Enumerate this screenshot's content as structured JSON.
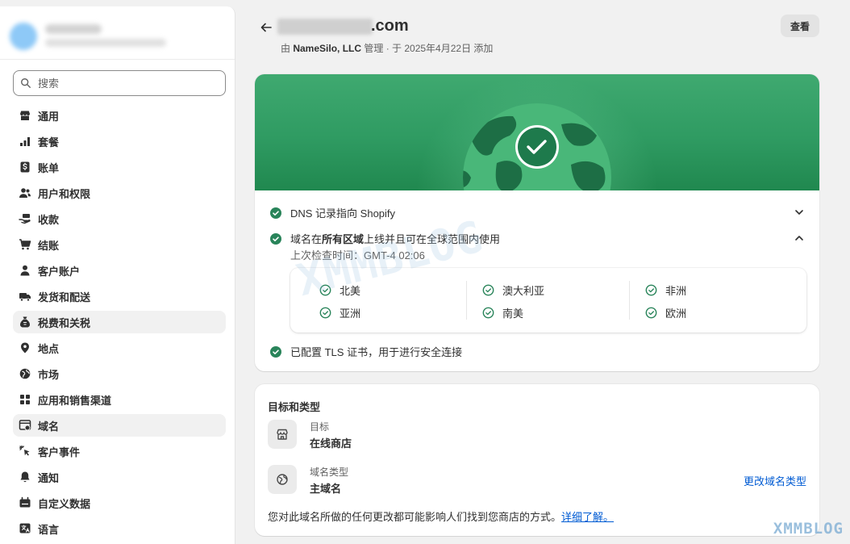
{
  "sidebar": {
    "search_placeholder": "搜索",
    "items": [
      {
        "label": "通用",
        "icon": "store-icon",
        "active": false
      },
      {
        "label": "套餐",
        "icon": "plan-chart-icon",
        "active": false
      },
      {
        "label": "账单",
        "icon": "billing-dollar-icon",
        "active": false
      },
      {
        "label": "用户和权限",
        "icon": "users-icon",
        "active": false
      },
      {
        "label": "收款",
        "icon": "payments-hand-icon",
        "active": false
      },
      {
        "label": "结账",
        "icon": "cart-icon",
        "active": false
      },
      {
        "label": "客户账户",
        "icon": "person-icon",
        "active": false
      },
      {
        "label": "发货和配送",
        "icon": "truck-icon",
        "active": false
      },
      {
        "label": "税费和关税",
        "icon": "tax-bag-icon",
        "active": true
      },
      {
        "label": "地点",
        "icon": "location-pin-icon",
        "active": false
      },
      {
        "label": "市场",
        "icon": "globe-icon",
        "active": false
      },
      {
        "label": "应用和销售渠道",
        "icon": "apps-grid-icon",
        "active": false
      },
      {
        "label": "域名",
        "icon": "domain-window-icon",
        "active": true
      },
      {
        "label": "客户事件",
        "icon": "cursor-click-icon",
        "active": false
      },
      {
        "label": "通知",
        "icon": "bell-icon",
        "active": false
      },
      {
        "label": "自定义数据",
        "icon": "custom-data-icon",
        "active": false
      },
      {
        "label": "语言",
        "icon": "language-icon",
        "active": false
      }
    ]
  },
  "header": {
    "domain_suffix": ".com",
    "subtitle_prefix": "由 ",
    "registrar": "NameSilo, LLC",
    "subtitle_suffix": " 管理 · 于 2025年4月22日 添加",
    "view_button": "查看"
  },
  "status": {
    "dns_text": "DNS 记录指向 Shopify",
    "availability_pre": "域名在",
    "availability_bold": "所有区域",
    "availability_post": "上线并且可在全球范围内使用",
    "last_check": "上次检查时间：GMT-4 02:06",
    "regions": [
      "北美",
      "澳大利亚",
      "非洲",
      "亚洲",
      "南美",
      "欧洲"
    ],
    "tls_text": "已配置 TLS 证书，用于进行安全连接"
  },
  "target_card": {
    "title": "目标和类型",
    "target_label": "目标",
    "target_value": "在线商店",
    "type_label": "域名类型",
    "type_value": "主域名",
    "change_link": "更改域名类型",
    "footnote": "您对此域名所做的任何更改都可能影响人们找到您商店的方式。",
    "learn_more": "详细了解。"
  },
  "watermark": "XMMBLOG",
  "colors": {
    "success": "#29845a",
    "link": "#005bd3",
    "banner": "#2f9b62"
  }
}
